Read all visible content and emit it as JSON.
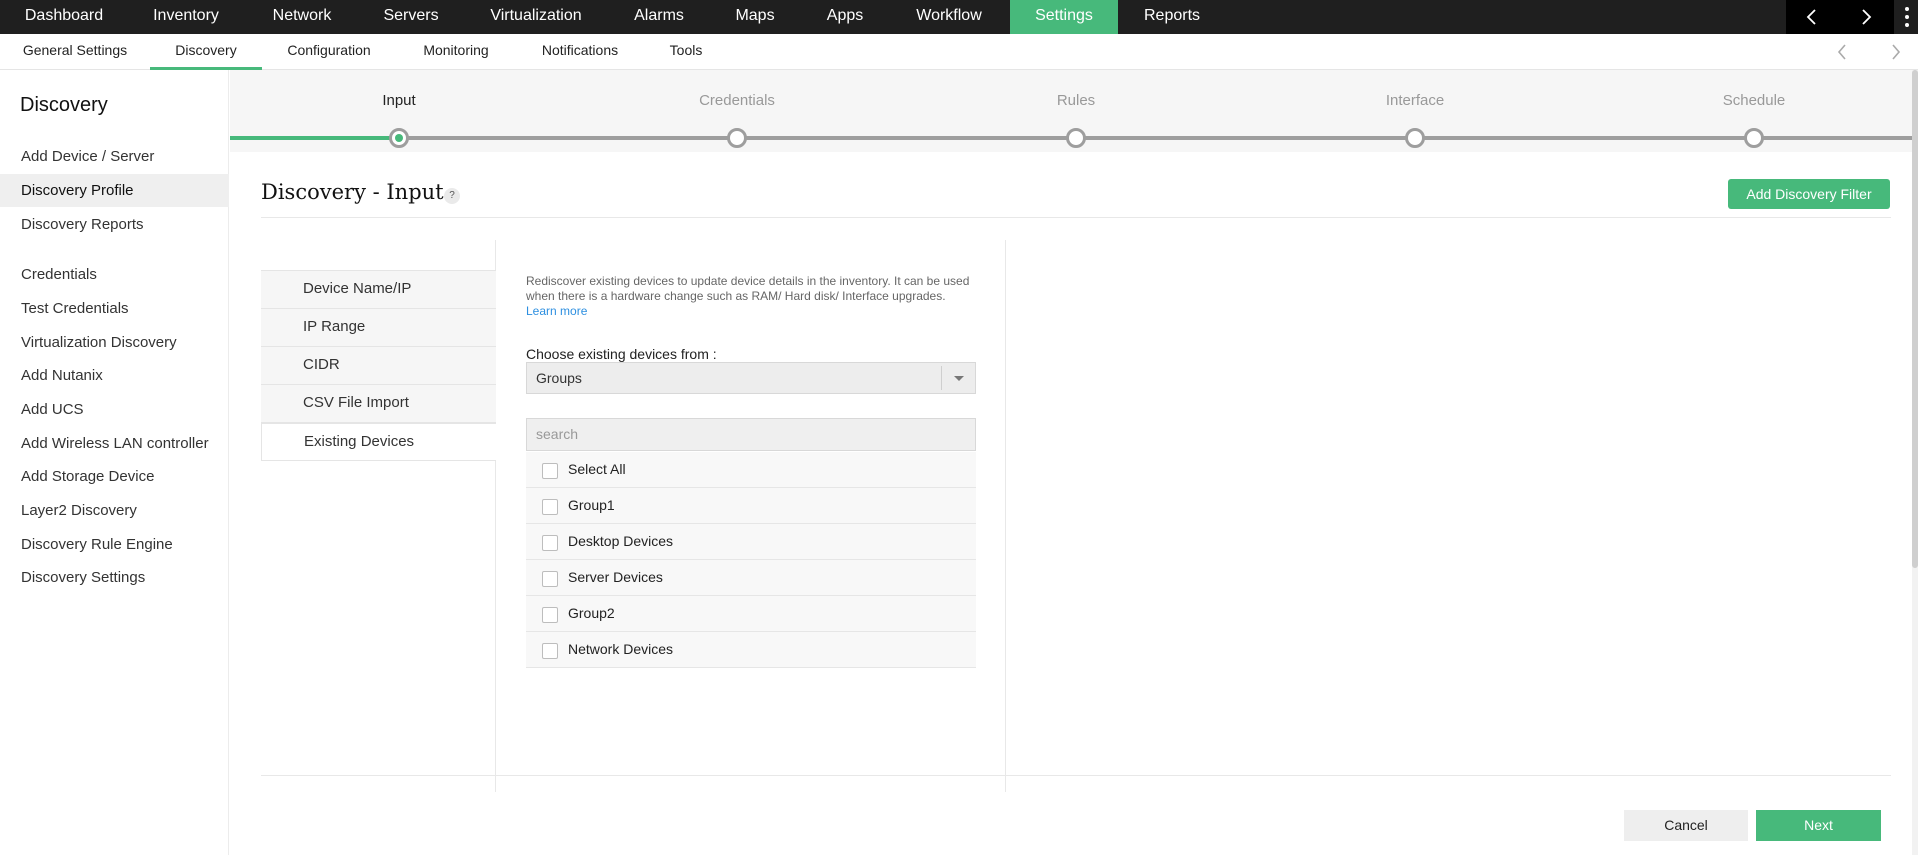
{
  "topnav": {
    "items": [
      "Dashboard",
      "Inventory",
      "Network",
      "Servers",
      "Virtualization",
      "Alarms",
      "Maps",
      "Apps",
      "Workflow",
      "Settings",
      "Reports"
    ],
    "active": "Settings"
  },
  "subnav": {
    "items": [
      "General Settings",
      "Discovery",
      "Configuration",
      "Monitoring",
      "Notifications",
      "Tools"
    ],
    "active": "Discovery"
  },
  "sidebar": {
    "title": "Discovery",
    "items": [
      "Add Device / Server",
      "Discovery Profile",
      "Discovery Reports",
      "Credentials",
      "Test Credentials",
      "Virtualization Discovery",
      "Add Nutanix",
      "Add UCS",
      "Add Wireless LAN controller",
      "Add Storage Device",
      "Layer2 Discovery",
      "Discovery Rule Engine",
      "Discovery Settings"
    ],
    "active": "Discovery Profile"
  },
  "stepper": {
    "steps": [
      "Input",
      "Credentials",
      "Rules",
      "Interface",
      "Schedule"
    ],
    "active": "Input"
  },
  "page": {
    "title": "Discovery - Input",
    "help": "?",
    "add_filter_label": "Add Discovery Filter"
  },
  "input_types": {
    "items": [
      "Device Name/IP",
      "IP Range",
      "CIDR",
      "CSV File Import",
      "Existing Devices"
    ],
    "active": "Existing Devices"
  },
  "existing": {
    "description": "Rediscover existing devices to update device details in the inventory. It can be used when there is a hardware change such as RAM/ Hard disk/ Interface upgrades.",
    "learn_more": "Learn more",
    "choose_label": "Choose existing devices from :",
    "choose_value": "Groups",
    "search_placeholder": "search",
    "options": [
      "Select All",
      "Group1",
      "Desktop Devices",
      "Server Devices",
      "Group2",
      "Network Devices"
    ]
  },
  "footer": {
    "cancel": "Cancel",
    "next": "Next"
  },
  "colors": {
    "accent": "#47b97b",
    "topnav_bg": "#1f1f1f",
    "link": "#2d8fe0"
  }
}
